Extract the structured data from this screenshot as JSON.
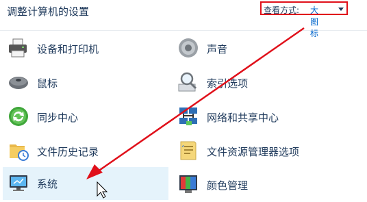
{
  "header": {
    "title": "调整计算机的设置",
    "view_by_label": "查看方式:",
    "view_by_value": "大图标"
  },
  "items": [
    {
      "label": "设备和打印机",
      "icon": "printer-icon"
    },
    {
      "label": "声音",
      "icon": "speaker-icon"
    },
    {
      "label": "鼠标",
      "icon": "mouse-icon"
    },
    {
      "label": "索引选项",
      "icon": "magnifier-icon"
    },
    {
      "label": "同步中心",
      "icon": "sync-icon"
    },
    {
      "label": "网络和共享中心",
      "icon": "network-icon"
    },
    {
      "label": "文件历史记录",
      "icon": "file-history-icon"
    },
    {
      "label": "文件资源管理器选项",
      "icon": "folder-options-icon"
    },
    {
      "label": "系统",
      "icon": "computer-icon"
    },
    {
      "label": "颜色管理",
      "icon": "color-management-icon"
    }
  ],
  "colors": {
    "accent": "#e0101a",
    "text": "#1e395b",
    "selected_bg": "#e5f3fb"
  }
}
